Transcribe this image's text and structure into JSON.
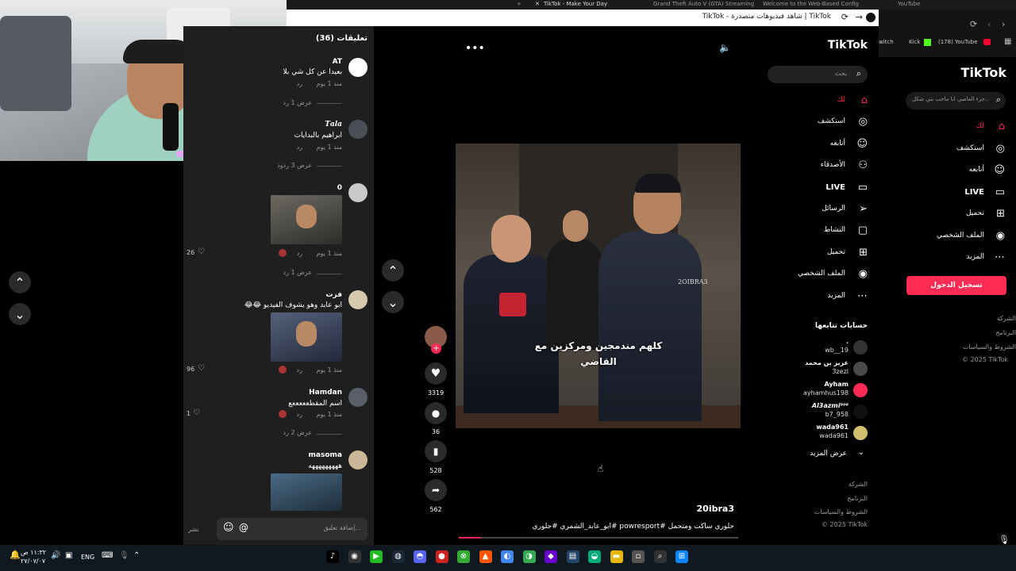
{
  "browser": {
    "tabs": [
      "TikTok - Make Your Day",
      "Grand Theft Auto V (GTA) Streaming",
      "Welcome to the Web-Based Config",
      "YouTube"
    ],
    "page_title": "TikTok | شاهد فيديوهات متصدرة - TikTok",
    "bookmarks": [
      "witch",
      "Kick",
      "(178) YouTube"
    ]
  },
  "comments": {
    "header": "تعليقات (36)",
    "items": [
      {
        "user": "AT",
        "text": "بعيدا عن كل شي بلا",
        "time": "منذ 1 يوم",
        "reply": "رد",
        "more": "عرض 1 رد"
      },
      {
        "user": "𝑻𝒂𝒍𝒂",
        "text": "ابراهيم بالبدايات",
        "time": "منذ 1 يوم",
        "reply": "رد",
        "more": "عرض 3 ردود"
      },
      {
        "user": "0",
        "likes": "26",
        "time": "منذ 1 يوم",
        "reply": "رد",
        "more": "عرض 1 رد"
      },
      {
        "user": "فزت",
        "text": "ابو عابد وهو يشوف الفيديو 😂😂",
        "likes": "96",
        "time": "منذ 1 يوم",
        "reply": "رد"
      },
      {
        "user": "Hamdan",
        "text": "اسم المقطعععععع",
        "likes": "1",
        "time": "منذ 1 يوم",
        "reply": "رد",
        "more": "عرض 2 رد"
      },
      {
        "user": "masoma",
        "text": "هههههههههه"
      }
    ],
    "input_placeholder": "إضافة تعليق...",
    "post_label": "نشر"
  },
  "video": {
    "caption_overlay": "كلهم مندمجين ومركزين مع القاضي",
    "watermark": "2OIBRA3",
    "author": "20ibra3",
    "description": "حلوري ساكت ومتحمل #powresport #ابو_عابد_الشمري #جلوري",
    "likes": "3319",
    "comments": "36",
    "saves": "528",
    "shares": "562"
  },
  "sidebar": {
    "logo": "TikTok",
    "search_placeholder": "بحث",
    "nav": [
      {
        "label": "لك",
        "icon": "home-icon"
      },
      {
        "label": "استكشف",
        "icon": "compass-icon"
      },
      {
        "label": "أتابعه",
        "icon": "following-icon"
      },
      {
        "label": "الأصدقاء",
        "icon": "friends-icon"
      },
      {
        "label": "LIVE",
        "icon": "live-icon"
      },
      {
        "label": "الرسائل",
        "icon": "messages-icon"
      },
      {
        "label": "النشاط",
        "icon": "activity-icon"
      },
      {
        "label": "تحميل",
        "icon": "upload-icon"
      },
      {
        "label": "الملف الشخصي",
        "icon": "profile-icon"
      },
      {
        "label": "المزيد",
        "icon": "more-icon"
      }
    ],
    "following_title": "حسابات تتابعها",
    "following": [
      {
        "name": ".",
        "handle": "wb__19"
      },
      {
        "name": "عزيز بن محمد",
        "handle": "3zezl"
      },
      {
        "name": "Ayham",
        "handle": "ayhamhus198"
      },
      {
        "name": "Al3azmi⁹⁰⁶",
        "handle": "b7_958"
      },
      {
        "name": "wada961",
        "handle": "wada961"
      }
    ],
    "show_more": "عرض المزيد",
    "footer": [
      "الشركة",
      "البرنامج",
      "الشروط والسياسات",
      "© 2025 TikTok"
    ]
  },
  "right_pane": {
    "logo": "TikTok",
    "search_placeholder": "جزء العاصي انا ماحب بتي شكل...",
    "nav": [
      {
        "label": "لك",
        "icon": "home-icon"
      },
      {
        "label": "استكشف",
        "icon": "compass-icon"
      },
      {
        "label": "أتابعه",
        "icon": "following-icon"
      },
      {
        "label": "LIVE",
        "icon": "live-icon"
      },
      {
        "label": "تحميل",
        "icon": "upload-icon"
      },
      {
        "label": "الملف الشخصي",
        "icon": "profile-icon"
      },
      {
        "label": "المزيد",
        "icon": "more-icon"
      }
    ],
    "login": "تسجيل الدخول",
    "footer": [
      "الشركة",
      "البرنامج",
      "الشروط والسياسات",
      "© 2025 TikTok"
    ]
  },
  "taskbar": {
    "time": "١١:٣٢ ص",
    "date": "٢٧/٠٧/٠٧",
    "lang": "ENG"
  },
  "colors": {
    "accent": "#fe2c55",
    "panel": "#1f1f1f",
    "taskbar": "#101820"
  }
}
